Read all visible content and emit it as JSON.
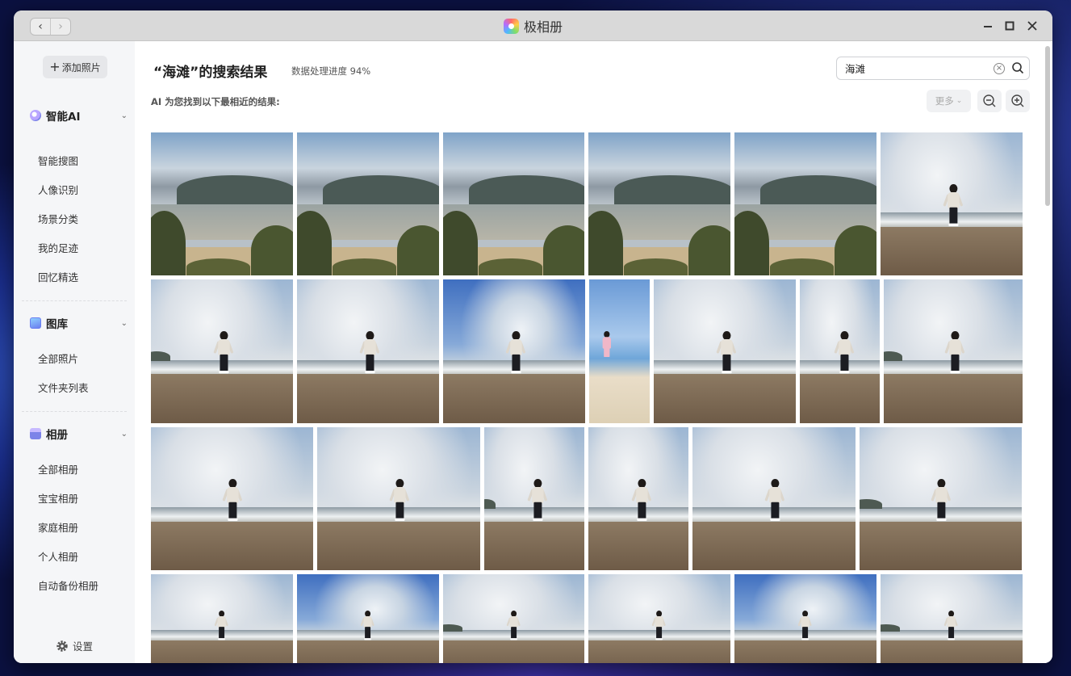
{
  "window": {
    "app_name": "极相册"
  },
  "sidebar": {
    "add_button": "添加照片",
    "sections": [
      {
        "label": "智能AI",
        "items": [
          "智能搜图",
          "人像识别",
          "场景分类",
          "我的足迹",
          "回忆精选"
        ]
      },
      {
        "label": "图库",
        "items": [
          "全部照片",
          "文件夹列表"
        ]
      },
      {
        "label": "相册",
        "items": [
          "全部相册",
          "宝宝相册",
          "家庭相册",
          "个人相册",
          "自动备份相册"
        ]
      }
    ],
    "settings": "设置"
  },
  "main": {
    "title": "“海滩”的搜索结果",
    "progress": "数据处理进度 94%",
    "subtitle": "AI 为您找到以下最相近的结果:",
    "search_value": "海滩",
    "more_label": "更多"
  },
  "colors": {
    "sidebar_bg": "#f5f6f8",
    "titlebar_bg": "#d9d9d9",
    "accent": "#7c83e8"
  },
  "photos": [
    {
      "kind": "coast"
    },
    {
      "kind": "coast"
    },
    {
      "kind": "coast"
    },
    {
      "kind": "coast"
    },
    {
      "kind": "coast"
    },
    {
      "kind": "person"
    },
    {
      "kind": "person"
    },
    {
      "kind": "person"
    },
    {
      "kind": "bluesky"
    },
    {
      "kind": "portrait"
    },
    {
      "kind": "person"
    },
    {
      "kind": "person"
    },
    {
      "kind": "person"
    },
    {
      "kind": "person"
    },
    {
      "kind": "person"
    },
    {
      "kind": "person"
    },
    {
      "kind": "person"
    },
    {
      "kind": "person"
    },
    {
      "kind": "person"
    },
    {
      "kind": "person"
    },
    {
      "kind": "bluesky"
    },
    {
      "kind": "person"
    },
    {
      "kind": "person"
    },
    {
      "kind": "bluesky"
    },
    {
      "kind": "person"
    }
  ]
}
